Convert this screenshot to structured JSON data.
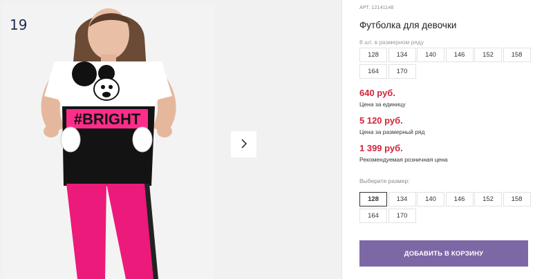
{
  "gallery": {
    "slide_number": "19",
    "shirt_print": "#BRIGHT",
    "next_icon": "chevron-right-icon"
  },
  "product": {
    "sku": "АРТ. 12141148",
    "title": "Футболка для девочки",
    "pack_note": "8 шт. в размерном ряду",
    "pack_sizes": [
      "128",
      "134",
      "140",
      "146",
      "152",
      "158",
      "164",
      "170"
    ],
    "unit_price": "640 руб.",
    "unit_price_caption": "Цена за единицу",
    "pack_price": "5 120 руб.",
    "pack_price_caption": "Цена за размерный ряд",
    "retail_price": "1 399 руб.",
    "retail_price_caption": "Рекомендуемая розничная цена",
    "choose_size_label": "Выберите размер:",
    "size_options": [
      "128",
      "134",
      "140",
      "146",
      "152",
      "158",
      "164",
      "170"
    ],
    "selected_size": "128",
    "add_to_cart_label": "ДОБАВИТЬ В КОРЗИНУ"
  },
  "colors": {
    "price": "#d0253a",
    "button": "#7d68a6"
  }
}
